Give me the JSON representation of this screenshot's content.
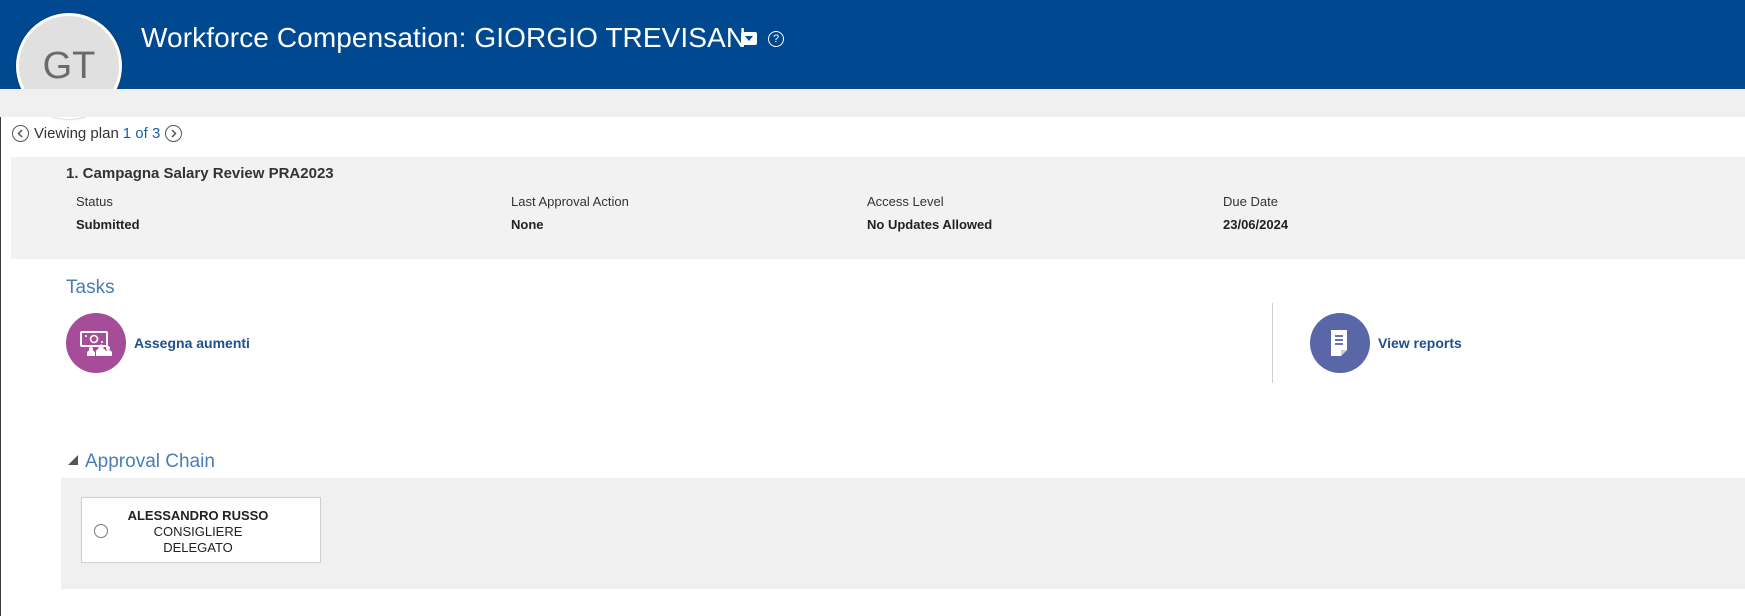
{
  "header": {
    "title": "Workforce Compensation: GIORGIO TREVISAN",
    "help_symbol": "?",
    "background_color": "#004990"
  },
  "avatar": {
    "initials": "GT"
  },
  "navigation": {
    "viewing_label": "Viewing plan",
    "count_text": "1 of 3"
  },
  "plan": {
    "title": "1. Campagna Salary Review PRA2023",
    "fields": [
      {
        "label": "Status",
        "value": "Submitted"
      },
      {
        "label": "Last Approval Action",
        "value": "None"
      },
      {
        "label": "Access Level",
        "value": "No Updates Allowed"
      },
      {
        "label": "Due Date",
        "value": "23/06/2024"
      }
    ]
  },
  "tasks": {
    "heading": "Tasks",
    "items": [
      {
        "label": "Assegna aumenti",
        "icon": "salary-payment-icon",
        "color": "#a64d9a"
      },
      {
        "label": "View reports",
        "icon": "report-document-icon",
        "color": "#5966a8"
      }
    ]
  },
  "approval_chain": {
    "heading": "Approval Chain",
    "approvers": [
      {
        "name": "ALESSANDRO RUSSO",
        "title_line1": "CONSIGLIERE",
        "title_line2": "DELEGATO"
      }
    ]
  }
}
